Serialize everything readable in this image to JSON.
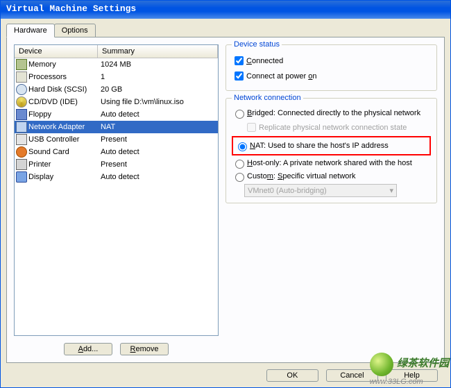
{
  "window": {
    "title": "Virtual Machine Settings"
  },
  "tabs": {
    "hardware": "Hardware",
    "options": "Options",
    "active": "hardware"
  },
  "list": {
    "header_device": "Device",
    "header_summary": "Summary",
    "rows": [
      {
        "icon": "ic-chip",
        "device": "Memory",
        "summary": "1024 MB",
        "selected": false
      },
      {
        "icon": "ic-cpu",
        "device": "Processors",
        "summary": "1",
        "selected": false
      },
      {
        "icon": "ic-hdd",
        "device": "Hard Disk (SCSI)",
        "summary": "20 GB",
        "selected": false
      },
      {
        "icon": "ic-cd",
        "device": "CD/DVD (IDE)",
        "summary": "Using file D:\\vm\\linux.iso",
        "selected": false
      },
      {
        "icon": "ic-floppy",
        "device": "Floppy",
        "summary": "Auto detect",
        "selected": false
      },
      {
        "icon": "ic-net",
        "device": "Network Adapter",
        "summary": "NAT",
        "selected": true
      },
      {
        "icon": "ic-usb",
        "device": "USB Controller",
        "summary": "Present",
        "selected": false
      },
      {
        "icon": "ic-snd",
        "device": "Sound Card",
        "summary": "Auto detect",
        "selected": false
      },
      {
        "icon": "ic-prn",
        "device": "Printer",
        "summary": "Present",
        "selected": false
      },
      {
        "icon": "ic-disp",
        "device": "Display",
        "summary": "Auto detect",
        "selected": false
      }
    ]
  },
  "buttons": {
    "add": "Add...",
    "remove": "Remove",
    "ok": "OK",
    "cancel": "Cancel",
    "help": "Help"
  },
  "device_status": {
    "legend": "Device status",
    "connected": {
      "label": "Connected",
      "checked": true
    },
    "connect_power": {
      "label": "Connect at power on",
      "checked": true
    }
  },
  "network_connection": {
    "legend": "Network connection",
    "bridged": {
      "label": "Bridged: Connected directly to the physical network",
      "checked": false
    },
    "replicate": {
      "label": "Replicate physical network connection state",
      "checked": false,
      "disabled": true
    },
    "nat": {
      "label": "NAT: Used to share the host's IP address",
      "checked": true
    },
    "hostonly": {
      "label": "Host-only: A private network shared with the host",
      "checked": false
    },
    "custom": {
      "label": "Custom: Specific virtual network",
      "checked": false
    },
    "vmnet": {
      "value": "VMnet0 (Auto-bridging)",
      "disabled": true
    }
  },
  "watermark": {
    "site": "www.33LG.com",
    "name": "绿茶软件园"
  }
}
